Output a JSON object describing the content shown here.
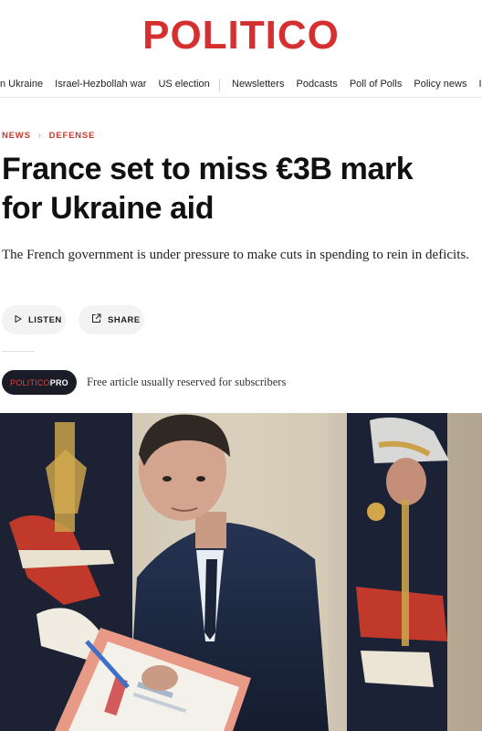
{
  "brand": {
    "logo_text": "POLITICO",
    "color": "#d62f2f"
  },
  "nav": {
    "left_items": [
      "n Ukraine",
      "Israel-Hezbollah war",
      "US election"
    ],
    "right_items": [
      "Newsletters",
      "Podcasts",
      "Poll of Polls",
      "Policy news",
      "I"
    ]
  },
  "breadcrumb": {
    "section": "NEWS",
    "subsection": "DEFENSE",
    "separator": "›"
  },
  "article": {
    "headline_line1": "France set to miss €3B mark",
    "headline_line2": "for Ukraine aid",
    "dek": "The French government is under pressure to make cuts in spending to rein in deficits."
  },
  "actions": {
    "listen_label": "LISTEN",
    "share_label": "SHARE",
    "listen_icon": "play-icon",
    "share_icon": "external-share-icon"
  },
  "pro": {
    "badge_part1": "POLITICO",
    "badge_part2": "PRO",
    "note": "Free article usually reserved for subscribers"
  },
  "photo": {
    "subject": "man-in-navy-suit-holding-folder-with-ceremonial-guards"
  }
}
